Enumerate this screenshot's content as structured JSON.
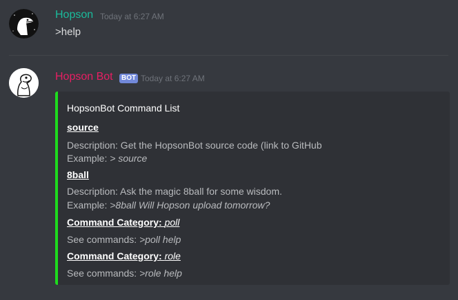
{
  "messages": [
    {
      "username": "Hopson",
      "username_color": "#1abc9c",
      "timestamp": "Today at 6:27 AM",
      "text": ">help",
      "avatar_icon": "dinosaur-avatar-icon"
    },
    {
      "username": "Hopson Bot",
      "username_color": "#e91e63",
      "bot_tag": "BOT",
      "timestamp": "Today at 6:27 AM",
      "avatar_icon": "dinosaur-avatar-icon"
    }
  ],
  "embed": {
    "accent_color": "#1edc1e",
    "title": "HopsonBot Command List",
    "fields": [
      {
        "name": "source",
        "description": "Description: Get the HopsonBot source code (link to GitHub",
        "example_label": "Example: ",
        "example_value": "> source"
      },
      {
        "name": "8ball",
        "description": "Description: Ask the magic 8ball for some wisdom.",
        "example_label": "Example: ",
        "example_value": ">8ball Will Hopson upload tomorrow?"
      }
    ],
    "categories": [
      {
        "label": "Command Category",
        "sep": ": ",
        "value": "poll",
        "see_label": "See commands: ",
        "see_value": ">poll help"
      },
      {
        "label": "Command Category",
        "sep": ": ",
        "value": "role",
        "see_label": "See commands: ",
        "see_value": ">role help"
      }
    ]
  }
}
